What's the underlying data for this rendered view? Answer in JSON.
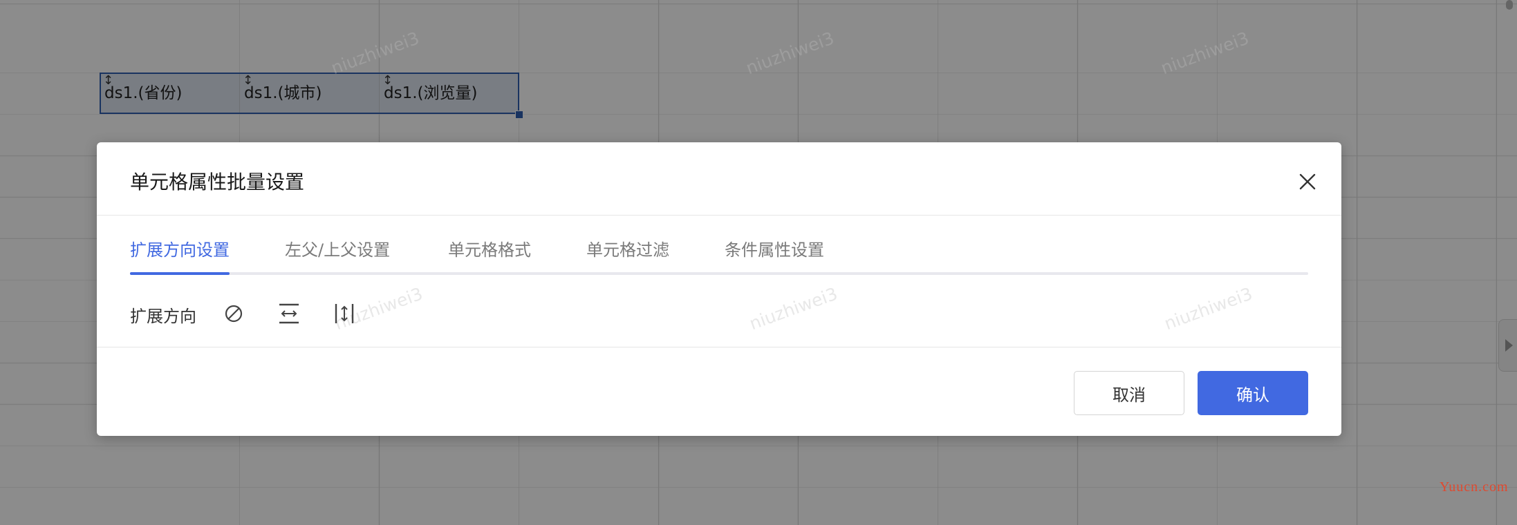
{
  "sheet": {
    "cells": [
      {
        "text": "ds1.(省份)",
        "arrow": "↕"
      },
      {
        "text": "ds1.(城市)",
        "arrow": "↕"
      },
      {
        "text": "ds1.(浏览量)",
        "arrow": "↕"
      }
    ]
  },
  "watermark": {
    "text": "niuzhiwei3"
  },
  "credit": {
    "text": "Yuucn.com",
    "color": "#e0492f"
  },
  "dialog": {
    "title": "单元格属性批量设置",
    "close_icon": "close-icon",
    "tabs": [
      {
        "label": "扩展方向设置",
        "active": true
      },
      {
        "label": "左父/上父设置",
        "active": false
      },
      {
        "label": "单元格格式",
        "active": false
      },
      {
        "label": "单元格过滤",
        "active": false
      },
      {
        "label": "条件属性设置",
        "active": false
      }
    ],
    "expand": {
      "label": "扩展方向",
      "options": [
        "no-expand-icon",
        "horizontal-expand-icon",
        "vertical-expand-icon"
      ]
    },
    "footer": {
      "cancel_label": "取消",
      "confirm_label": "确认"
    }
  },
  "colors": {
    "accent": "#4169e1",
    "selection": "#2f5db0",
    "overlay": "rgba(0,0,0,0.45)"
  }
}
